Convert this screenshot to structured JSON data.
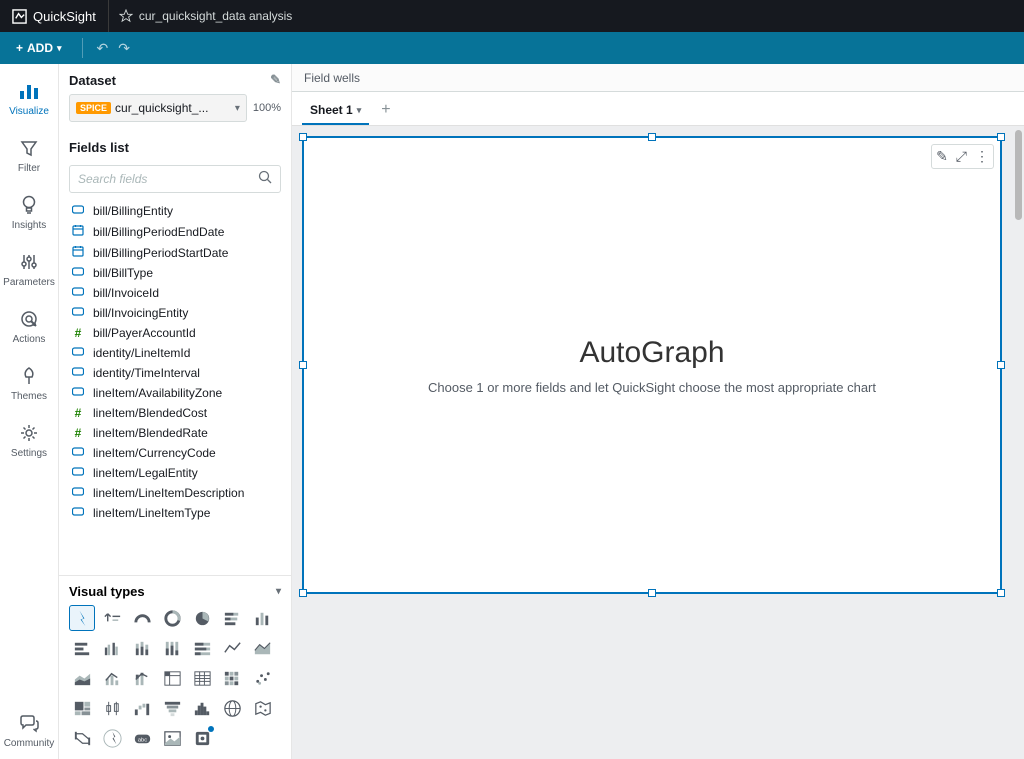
{
  "brand": "QuickSight",
  "analysis_name": "cur_quicksight_data analysis",
  "add_label": "ADD",
  "leftnav": [
    {
      "key": "visualize",
      "label": "Visualize"
    },
    {
      "key": "filter",
      "label": "Filter"
    },
    {
      "key": "insights",
      "label": "Insights"
    },
    {
      "key": "parameters",
      "label": "Parameters"
    },
    {
      "key": "actions",
      "label": "Actions"
    },
    {
      "key": "themes",
      "label": "Themes"
    },
    {
      "key": "settings",
      "label": "Settings"
    }
  ],
  "community_label": "Community",
  "dataset": {
    "section": "Dataset",
    "tag": "SPICE",
    "name": "cur_quicksight_...",
    "pct": "100%"
  },
  "fields_section": "Fields list",
  "search_placeholder": "Search fields",
  "fields": [
    {
      "type": "text",
      "name": "bill/BillingEntity"
    },
    {
      "type": "date",
      "name": "bill/BillingPeriodEndDate"
    },
    {
      "type": "date",
      "name": "bill/BillingPeriodStartDate"
    },
    {
      "type": "text",
      "name": "bill/BillType"
    },
    {
      "type": "text",
      "name": "bill/InvoiceId"
    },
    {
      "type": "text",
      "name": "bill/InvoicingEntity"
    },
    {
      "type": "num",
      "name": "bill/PayerAccountId"
    },
    {
      "type": "text",
      "name": "identity/LineItemId"
    },
    {
      "type": "text",
      "name": "identity/TimeInterval"
    },
    {
      "type": "text",
      "name": "lineItem/AvailabilityZone"
    },
    {
      "type": "num",
      "name": "lineItem/BlendedCost"
    },
    {
      "type": "num",
      "name": "lineItem/BlendedRate"
    },
    {
      "type": "text",
      "name": "lineItem/CurrencyCode"
    },
    {
      "type": "text",
      "name": "lineItem/LegalEntity"
    },
    {
      "type": "text",
      "name": "lineItem/LineItemDescription"
    },
    {
      "type": "text",
      "name": "lineItem/LineItemType"
    }
  ],
  "visual_types_label": "Visual types",
  "field_wells_label": "Field wells",
  "sheet_tab": "Sheet 1",
  "autograph": {
    "title": "AutoGraph",
    "subtitle": "Choose 1 or more fields and let QuickSight choose the most appropriate chart"
  }
}
